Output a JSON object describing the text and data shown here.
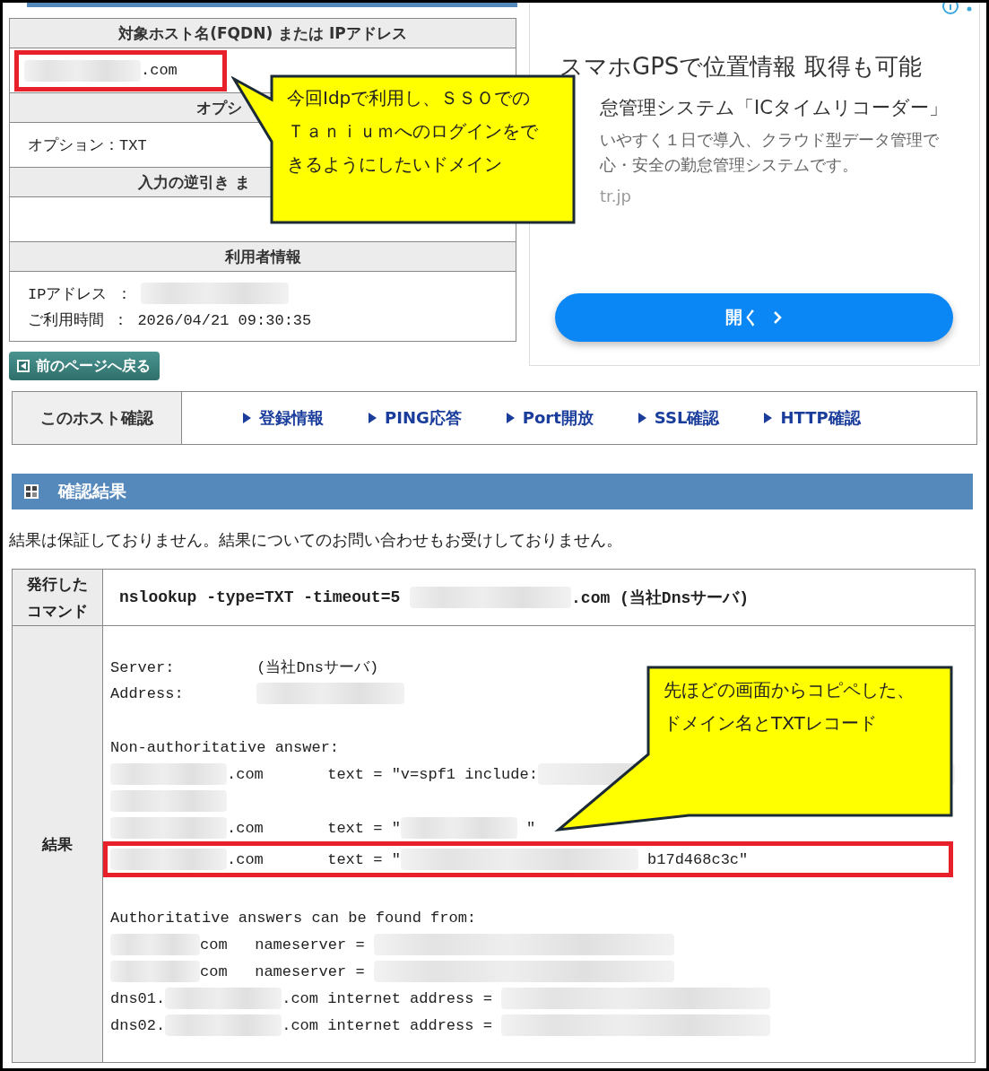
{
  "host_table": {
    "sections": [
      {
        "heading": "対象ホスト名(FQDN) または IPアドレス",
        "highlighted": true,
        "lines": [
          [
            {
              "kind": "blur-host"
            },
            {
              "kind": "text",
              "text": ".com"
            }
          ]
        ]
      },
      {
        "heading": "オプシ",
        "highlighted": false,
        "lines": [
          [
            {
              "kind": "text",
              "text": "オプション：TXT"
            }
          ]
        ]
      },
      {
        "heading": "入力の逆引き ま",
        "highlighted": false
      },
      {
        "heading": "利用者情報",
        "highlighted": false,
        "lines": [
          [
            {
              "kind": "text",
              "text": "IPアドレス ： "
            },
            {
              "kind": "blur-ip"
            }
          ],
          [
            {
              "kind": "text",
              "text": "ご利用時間 ： 2026/04/21 09:30:35"
            }
          ]
        ]
      }
    ]
  },
  "back_button": {
    "label": "前のページへ戻る"
  },
  "ad": {
    "headline": "スマホGPSで位置情報 取得も可能",
    "subhead": "怠管理システム「ICタイムリコーダー」",
    "body_lines": [
      "いやすく１日で導入、クラウド型データ管理で",
      "心・安全の勤怠管理システムです。"
    ],
    "domain": "tr.jp",
    "button": "開く"
  },
  "host_nav": {
    "label": "このホスト確認",
    "links": [
      "登録情報",
      "PING応答",
      "Port開放",
      "SSL確認",
      "HTTP確認"
    ]
  },
  "result_section": {
    "title": "確認結果",
    "notice": "結果は保証しておりません。結果についてのお問い合わせもお受けしておりません。"
  },
  "result_table": {
    "rows": [
      {
        "label": "発行したコマンド",
        "lines": [
          {
            "highlighted": false,
            "segments": [
              {
                "kind": "text",
                "text": "nslookup -type=TXT -timeout=5 "
              },
              {
                "kind": "blur-cmd"
              },
              {
                "kind": "text",
                "text": ".com (当社Dnsサーバ)"
              }
            ]
          }
        ]
      },
      {
        "label": "結果",
        "lines": [
          {
            "highlighted": false,
            "segments": [
              {
                "kind": "text",
                "text": "Server:         (当社Dnsサーバ)"
              }
            ]
          },
          {
            "highlighted": false,
            "segments": [
              {
                "kind": "text",
                "text": "Address:        "
              },
              {
                "kind": "blur-ip"
              }
            ]
          },
          {
            "highlighted": false
          },
          {
            "highlighted": false,
            "segments": [
              {
                "kind": "text",
                "text": "Non-authoritative answer:"
              }
            ]
          },
          {
            "highlighted": false,
            "segments": [
              {
                "kind": "blur-host"
              },
              {
                "kind": "text",
                "text": ".com       text = \"v=spf1 include:"
              },
              {
                "kind": "blur-spf"
              }
            ]
          },
          {
            "highlighted": false,
            "segments": [
              {
                "kind": "blur-host"
              }
            ]
          },
          {
            "highlighted": false,
            "segments": [
              {
                "kind": "blur-host"
              },
              {
                "kind": "text",
                "text": ".com       text = \""
              },
              {
                "kind": "blur-value"
              },
              {
                "kind": "text",
                "text": " \""
              }
            ]
          },
          {
            "highlighted": true,
            "segments": [
              {
                "kind": "blur-host"
              },
              {
                "kind": "text",
                "text": ".com       text = \""
              },
              {
                "kind": "blur-hash"
              },
              {
                "kind": "text",
                "text": " b17d468c3c\""
              }
            ]
          },
          {
            "highlighted": false
          },
          {
            "highlighted": false,
            "segments": [
              {
                "kind": "text",
                "text": "Authoritative answers can be found from:"
              }
            ]
          },
          {
            "highlighted": false,
            "segments": [
              {
                "kind": "blur-domain"
              },
              {
                "kind": "text",
                "text": "com   nameserver = "
              },
              {
                "kind": "blur-ns"
              }
            ]
          },
          {
            "highlighted": false,
            "segments": [
              {
                "kind": "blur-domain"
              },
              {
                "kind": "text",
                "text": "com   nameserver = "
              },
              {
                "kind": "blur-ns"
              }
            ]
          },
          {
            "highlighted": false,
            "segments": [
              {
                "kind": "text",
                "text": "dns01."
              },
              {
                "kind": "blur-host"
              },
              {
                "kind": "text",
                "text": ".com internet address = "
              },
              {
                "kind": "blur-addr"
              }
            ]
          },
          {
            "highlighted": false,
            "segments": [
              {
                "kind": "text",
                "text": "dns02."
              },
              {
                "kind": "blur-host"
              },
              {
                "kind": "text",
                "text": ".com internet address = "
              },
              {
                "kind": "blur-addr"
              }
            ]
          }
        ]
      }
    ]
  },
  "callouts": [
    {
      "lines": [
        "今回Idpで利用し、ＳＳＯでの",
        "Ｔａｎｉｕｍへのログインをで",
        "きるようにしたいドメイン"
      ]
    },
    {
      "lines": [
        "先ほどの画面からコピペした、",
        "ドメイン名とTXTレコード"
      ]
    }
  ]
}
